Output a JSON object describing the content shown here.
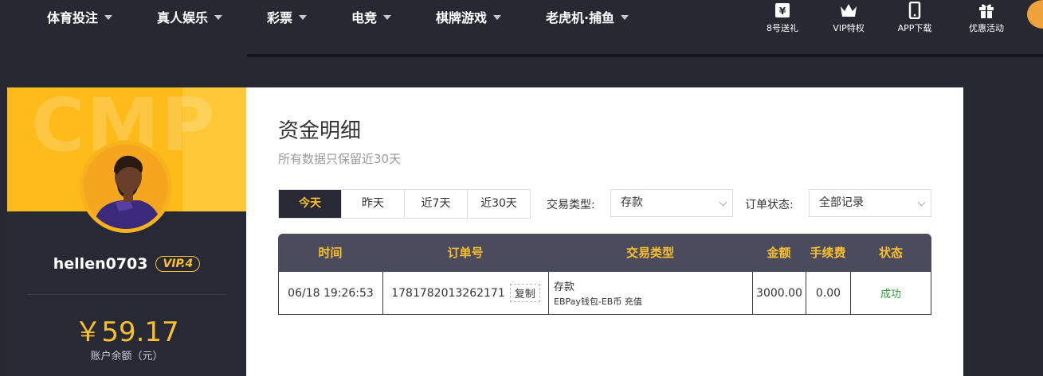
{
  "nav": {
    "items": [
      {
        "label": "体育投注"
      },
      {
        "label": "真人娱乐"
      },
      {
        "label": "彩票"
      },
      {
        "label": "电竞"
      },
      {
        "label": "棋牌游戏"
      },
      {
        "label": "老虎机·捕鱼"
      }
    ],
    "quick": [
      {
        "label": "8号送礼",
        "icon": "gift-ticket-icon"
      },
      {
        "label": "VIP特权",
        "icon": "crown-icon"
      },
      {
        "label": "APP下载",
        "icon": "phone-icon"
      },
      {
        "label": "优惠活动",
        "icon": "gift-box-icon"
      }
    ]
  },
  "profile": {
    "banner_text": "CMP",
    "username": "hellen0703",
    "vip": "VIP.4",
    "balance": "￥59.17",
    "balance_label": "账户余额（元）"
  },
  "page": {
    "title": "资金明细",
    "subtitle": "所有数据只保留近30天"
  },
  "filters": {
    "tabs": [
      "今天",
      "昨天",
      "近7天",
      "近30天"
    ],
    "active_tab": 0,
    "type_label": "交易类型:",
    "type_value": "存款",
    "status_label": "订单状态:",
    "status_value": "全部记录"
  },
  "table": {
    "headers": [
      "时间",
      "订单号",
      "交易类型",
      "金额",
      "手续费",
      "状态"
    ],
    "rows": [
      {
        "time": "06/18 19:26:53",
        "order": "1781782013262171",
        "copy": "复制",
        "type_main": "存款",
        "type_sub": "EBPay钱包-EB币 充值",
        "amount": "3000.00",
        "fee": "0.00",
        "status": "成功"
      }
    ]
  },
  "colors": {
    "accent": "#fcbf2d",
    "dark": "#272935",
    "success": "#2e9e3e"
  }
}
